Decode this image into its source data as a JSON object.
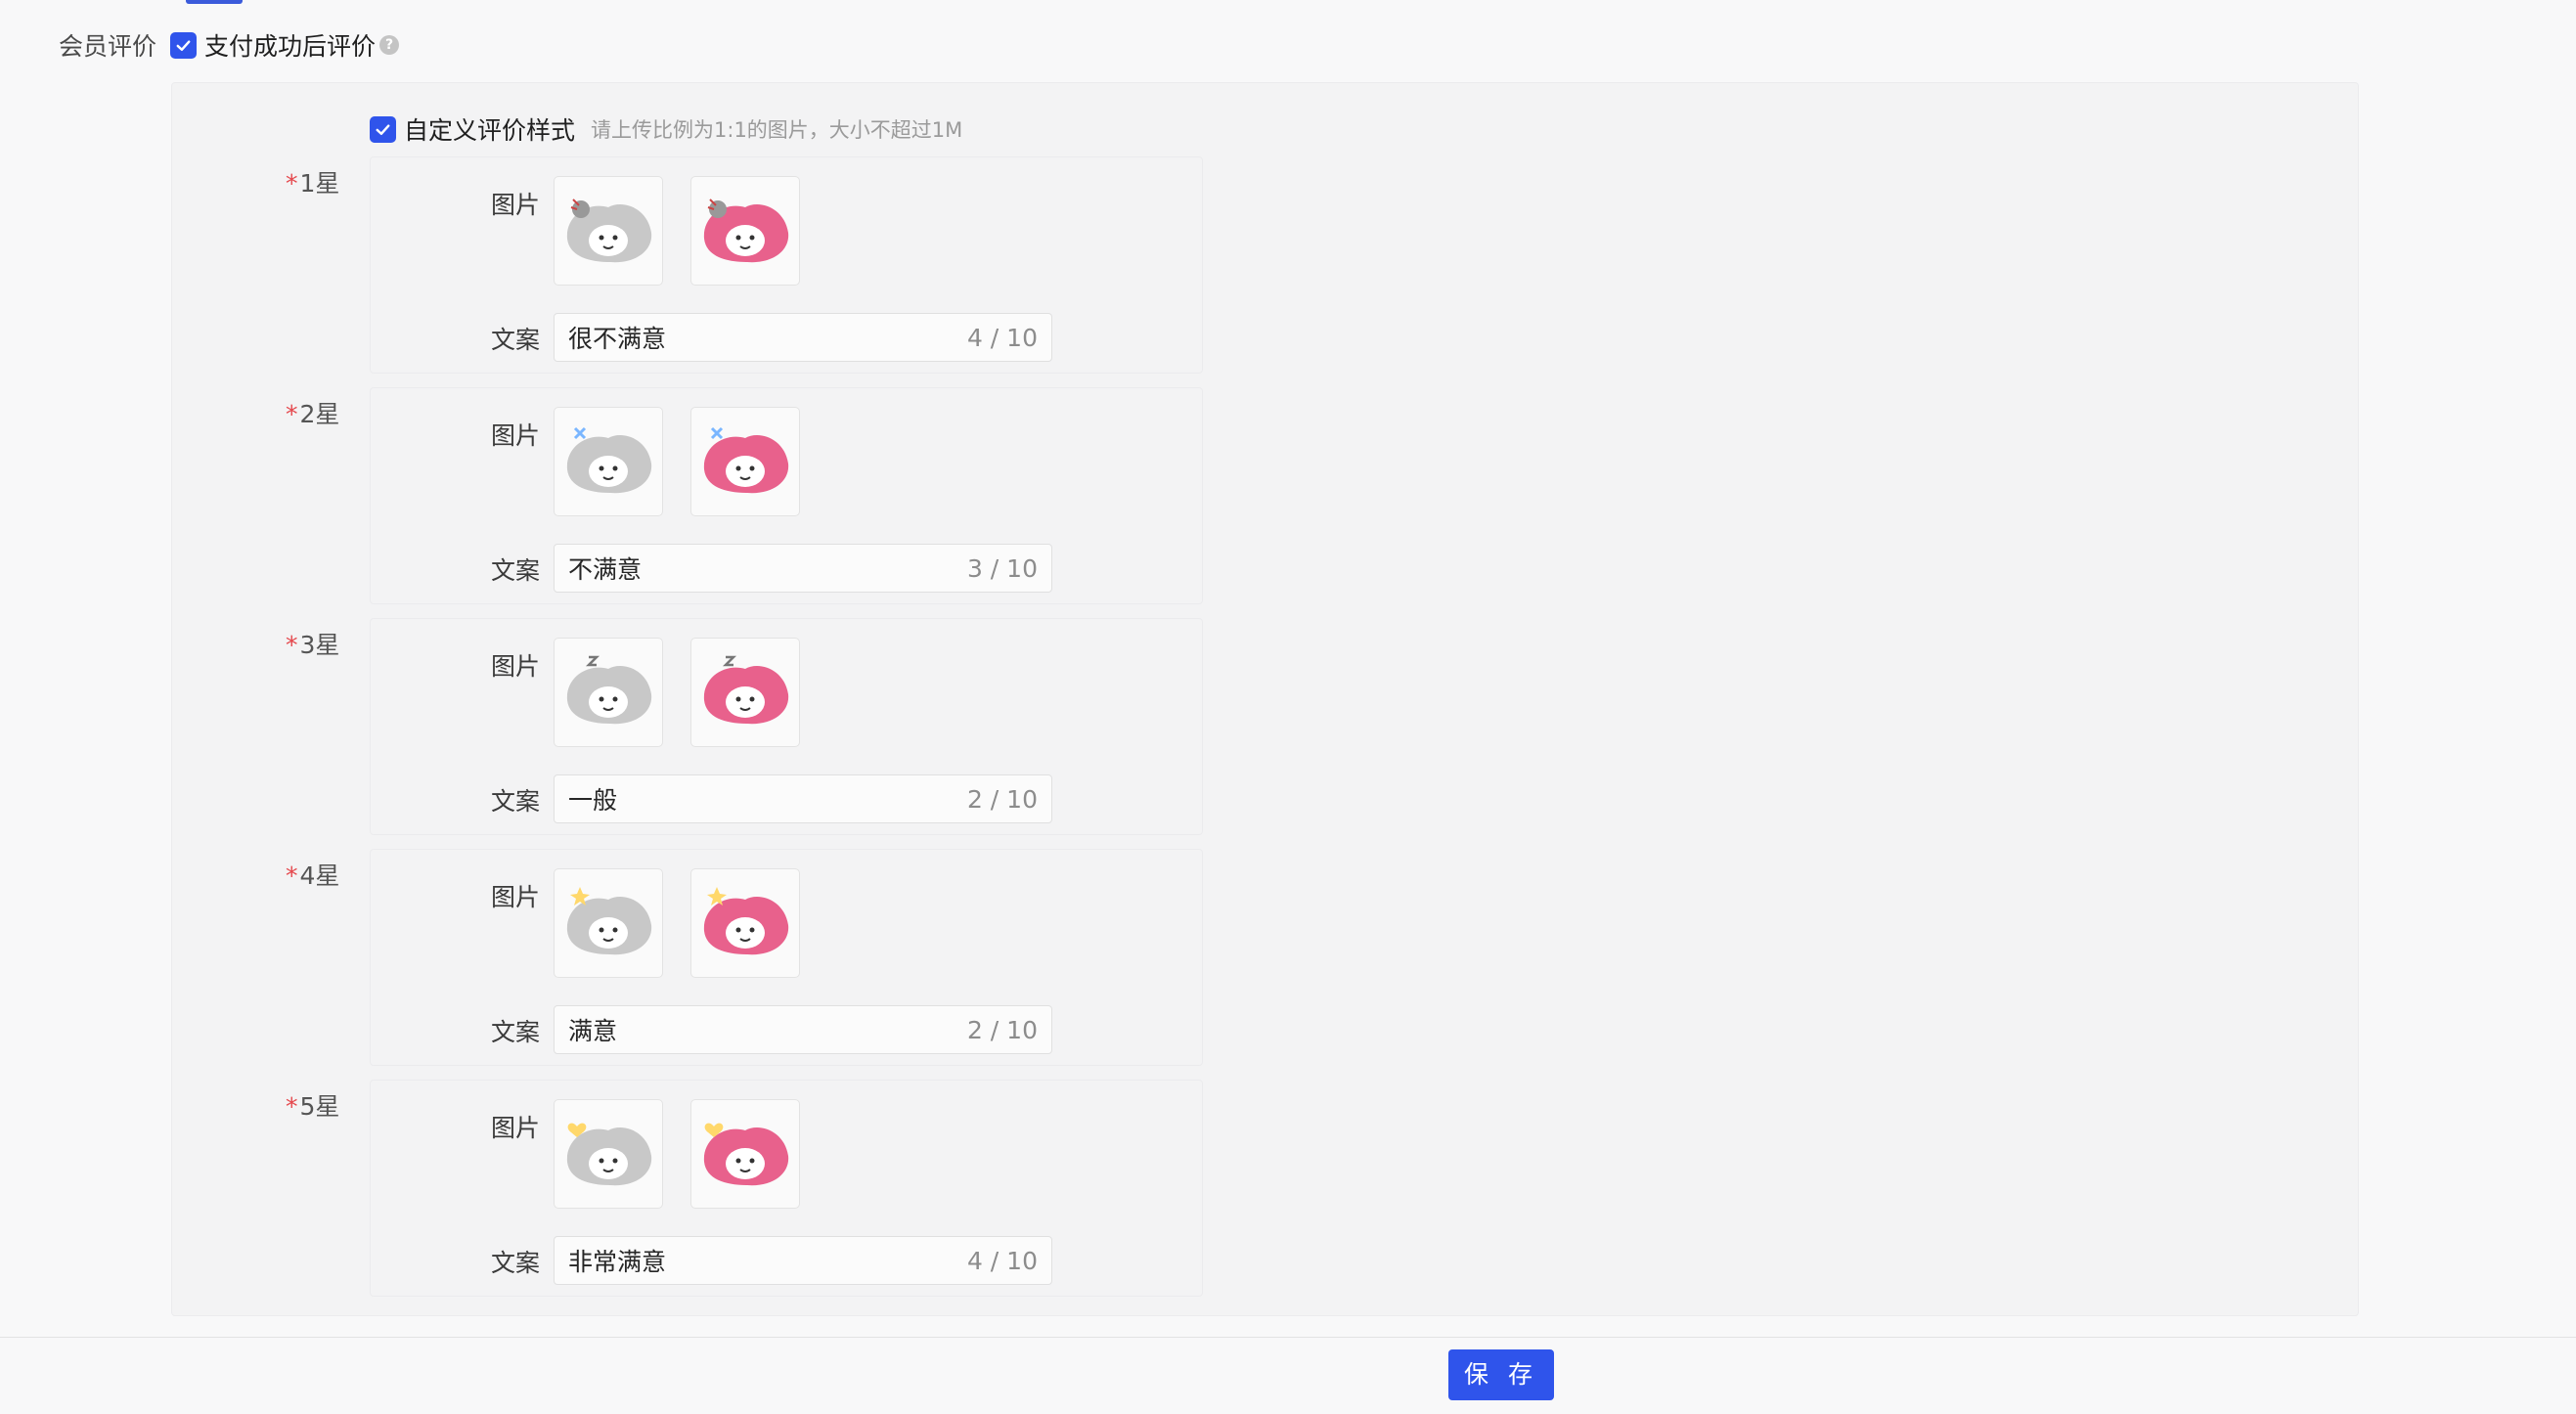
{
  "member_review": {
    "label": "会员评价",
    "checkbox_label": "支付成功后评价",
    "checked": true,
    "help": "?"
  },
  "custom_style": {
    "checkbox_label": "自定义评价样式",
    "checked": true,
    "hint": "请上传比例为1:1的图片，大小不超过1M"
  },
  "field_labels": {
    "image": "图片",
    "text": "文案"
  },
  "stars": [
    {
      "required_mark": "*",
      "label": "1星",
      "text": "很不满意",
      "count": "4 / 10",
      "icons": [
        "angry-gray-icon",
        "angry-pink-icon"
      ]
    },
    {
      "required_mark": "*",
      "label": "2星",
      "text": "不满意",
      "count": "3 / 10",
      "icons": [
        "annoyed-gray-icon",
        "annoyed-pink-icon"
      ]
    },
    {
      "required_mark": "*",
      "label": "3星",
      "text": "一般",
      "count": "2 / 10",
      "icons": [
        "sleepy-gray-icon",
        "sleepy-pink-icon"
      ]
    },
    {
      "required_mark": "*",
      "label": "4星",
      "text": "满意",
      "count": "2 / 10",
      "icons": [
        "smile-gray-icon",
        "smile-pink-icon"
      ]
    },
    {
      "required_mark": "*",
      "label": "5星",
      "text": "非常满意",
      "count": "4 / 10",
      "icons": [
        "love-gray-icon",
        "love-pink-icon"
      ]
    }
  ],
  "footer": {
    "save_label": "保 存"
  },
  "colors": {
    "primary": "#2f54eb",
    "pink": "#e8618c",
    "gray_face": "#c8c8c8",
    "required": "#e5484d"
  }
}
